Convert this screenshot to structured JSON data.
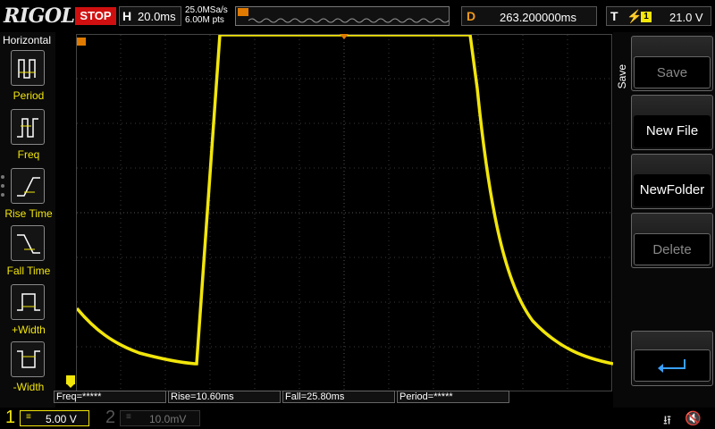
{
  "brand": "RIGOL",
  "run_state": "STOP",
  "horizontal": {
    "label": "H",
    "timebase": "20.0ms",
    "sample_rate": "25.0MSa/s",
    "memory_depth": "6.00M pts"
  },
  "delay": {
    "label": "D",
    "value": "263.200000ms"
  },
  "trigger": {
    "label": "T",
    "source": "1",
    "level": "21.0 V"
  },
  "left_panel": {
    "title": "Horizontal",
    "items": [
      {
        "label": "Period",
        "icon": "period-icon"
      },
      {
        "label": "Freq",
        "icon": "freq-icon"
      },
      {
        "label": "Rise Time",
        "icon": "rise-time-icon"
      },
      {
        "label": "Fall Time",
        "icon": "fall-time-icon"
      },
      {
        "label": "+Width",
        "icon": "pos-width-icon"
      },
      {
        "label": "-Width",
        "icon": "neg-width-icon"
      }
    ]
  },
  "measurements": {
    "freq": "Freq=*****",
    "rise": "Rise=10.60ms",
    "fall": "Fall=25.80ms",
    "period": "Period=*****"
  },
  "menu": {
    "title": "Save",
    "buttons": [
      {
        "label": "Save",
        "enabled": false
      },
      {
        "label": "New File",
        "enabled": true
      },
      {
        "label": "NewFolder",
        "enabled": true
      },
      {
        "label": "Delete",
        "enabled": false
      }
    ],
    "return_icon": "return-arrow-icon"
  },
  "channels": [
    {
      "number": "1",
      "coupling": "≡",
      "scale": "5.00 V",
      "active": true
    },
    {
      "number": "2",
      "coupling": "≡",
      "scale": "10.0mV",
      "active": false
    }
  ],
  "colors": {
    "ch1": "#f2e60a",
    "stop": "#d01010",
    "delay": "#f29a1a",
    "marker": "#e07a00"
  }
}
